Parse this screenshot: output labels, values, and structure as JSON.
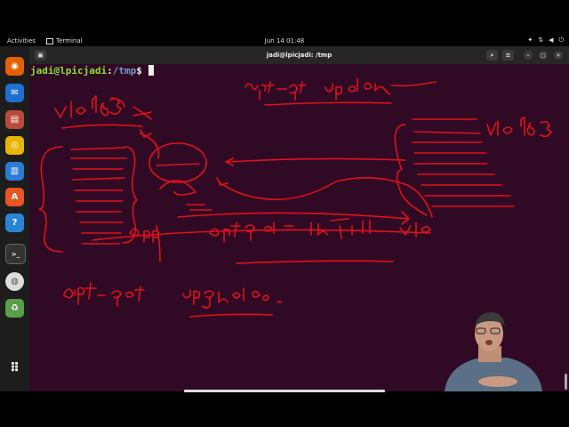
{
  "topbar": {
    "activities": "Activities",
    "app_name": "Terminal",
    "clock": "Jun 14  01:48"
  },
  "window": {
    "title": "jadi@lpicjadi: /tmp"
  },
  "terminal": {
    "prompt_user": "jadi@lpicjadi",
    "prompt_sep": ":",
    "prompt_path": "/tmp",
    "prompt_symbol": "$"
  },
  "dock": [
    {
      "name": "firefox-icon",
      "color": "#e66000"
    },
    {
      "name": "thunderbird-icon",
      "color": "#1f6fd1"
    },
    {
      "name": "files-icon",
      "color": "#b94a3a"
    },
    {
      "name": "rhythmbox-icon",
      "color": "#e8b400"
    },
    {
      "name": "writer-icon",
      "color": "#2a7bd6"
    },
    {
      "name": "software-icon",
      "color": "#e95420"
    },
    {
      "name": "help-icon",
      "color": "#2a84d6"
    },
    {
      "name": "terminal-icon",
      "color": "#333333"
    },
    {
      "name": "disc-icon",
      "color": "#dddddd"
    },
    {
      "name": "trash-icon",
      "color": "#5a9e4b"
    },
    {
      "name": "app-grid-icon",
      "color": "#1d1d1d"
    }
  ],
  "annotations": {
    "color": "#e0101c",
    "texts": [
      "apt-get update",
      "vlc 16.3",
      "vlc 16.3",
      "app",
      "apt-get install vlc",
      "apt-get upgrade"
    ]
  }
}
